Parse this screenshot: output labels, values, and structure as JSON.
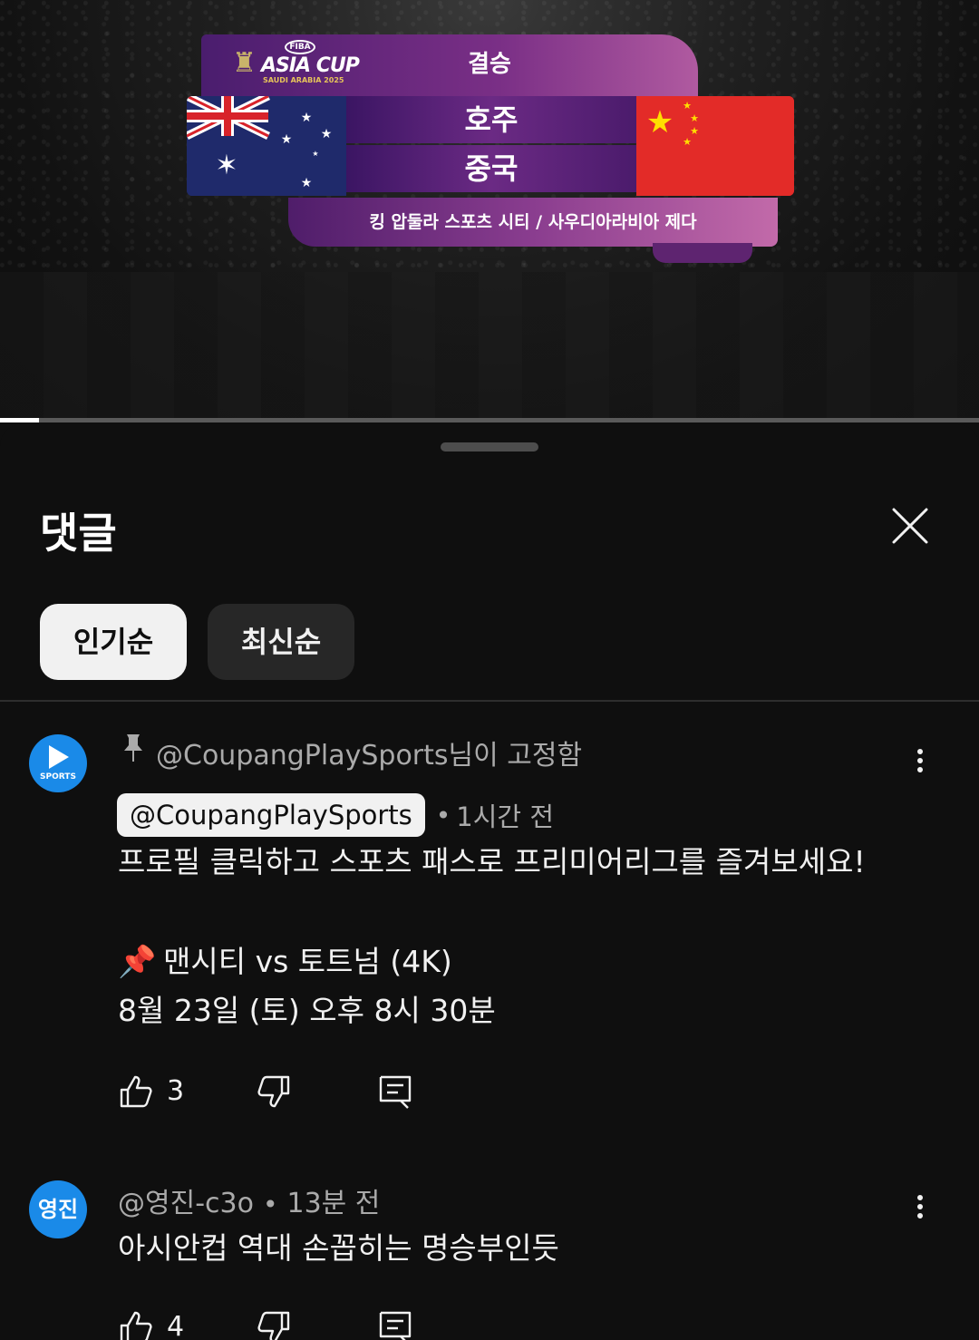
{
  "video": {
    "round": "결승",
    "team1": "호주",
    "team2": "중국",
    "venue": "킹 압둘라 스포츠 시티 / 사우디아라비아 제다",
    "logo_fiba": "FIBA",
    "logo_text": "ASIA CUP",
    "logo_sub": "SAUDI ARABIA 2025",
    "progress_fraction": 0.04
  },
  "sheet": {
    "title": "댓글",
    "close_icon": "close-icon",
    "sort_chips": [
      "인기순",
      "최신순"
    ]
  },
  "comments": [
    {
      "pinned_text": "@CoupangPlaySports님이 고정함",
      "author": "@CoupangPlaySports",
      "time": "1시간 전",
      "avatar_label": "SPORTS",
      "lines": [
        "프로필 클릭하고 스포츠 패스로 프리미어리그를 즐겨보세요!",
        "맨시티 vs 토트넘 (4K)",
        "8월 23일 (토) 오후 8시 30분"
      ],
      "likes": "3"
    },
    {
      "author": "@영진-c3o",
      "time": "13분 전",
      "avatar_label": "영진",
      "lines": [
        "아시안컵 역대 손꼽히는 명승부인듯"
      ],
      "likes": "4"
    }
  ],
  "colors": {
    "background": "#0f0f0f",
    "avatar_blue": "#1a8ae8",
    "banner_purple": "#6b2a84",
    "china_red": "#e32b28",
    "australia_blue": "#1f2a6b"
  }
}
